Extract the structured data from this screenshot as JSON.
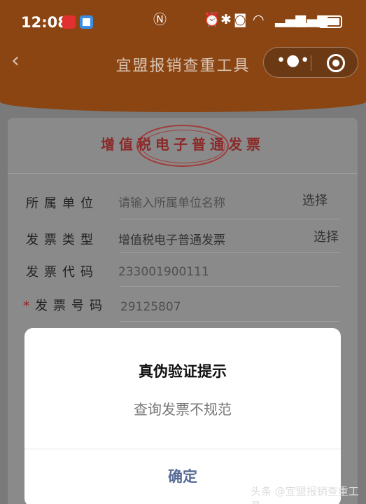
{
  "statusbar": {
    "time": "12:08",
    "app_icons": [
      "red-app-icon",
      "blue-app-icon"
    ],
    "right_icons": [
      "nfc-icon",
      "alarm-icon",
      "bluetooth-icon",
      "camera-icon",
      "wifi-icon",
      "signal-icon",
      "signal-icon",
      "battery-icon"
    ]
  },
  "navbar": {
    "back_icon": "chevron-left-icon",
    "title": "宜盟报销查重工具",
    "more_icon": "more-dots-icon",
    "close_icon": "target-icon"
  },
  "invoice": {
    "title": "增值税电子普通发票",
    "fields": [
      {
        "label": "所属单位",
        "value": "",
        "placeholder": "请输入所属单位名称",
        "action": "选择",
        "required": false
      },
      {
        "label": "发票类型",
        "value": "增值税电子普通发票",
        "placeholder": "",
        "action": "选择",
        "required": false
      },
      {
        "label": "发票代码",
        "value": "",
        "placeholder": "233001900111",
        "action": "",
        "required": false
      },
      {
        "label": "发票号码",
        "value": "",
        "placeholder": "29125807",
        "action": "",
        "required": true,
        "required_mark": "*"
      }
    ]
  },
  "dialog": {
    "title": "真伪验证提示",
    "message": "查询发票不规范",
    "confirm_label": "确定"
  },
  "watermark": "头条 @宜盟报销查重工具",
  "colors": {
    "header_brown": "#8b4513",
    "invoice_title_red": "#8b2a2a",
    "dialog_button_blue": "#576b95"
  }
}
